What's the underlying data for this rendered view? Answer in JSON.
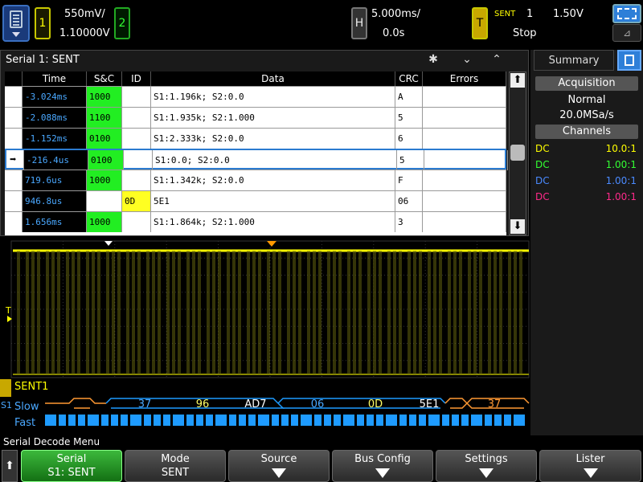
{
  "top": {
    "ch1_num": "1",
    "ch1_scale": "550mV/",
    "ch1_offset": "1.10000V",
    "ch2_num": "2",
    "h_label": "H",
    "h_scale": "5.000ms/",
    "h_delay": "0.0s",
    "t_label": "T",
    "trig_type": "SENT",
    "trig_source": "1",
    "trig_level": "1.50V",
    "run_state": "Stop",
    "zoom_icon": "zoom-icon",
    "menu_icon": "menu-icon"
  },
  "lister": {
    "title": "Serial 1: SENT",
    "headers": [
      "Time",
      "S&C",
      "ID",
      "Data",
      "CRC",
      "Errors"
    ],
    "rows": [
      {
        "time": "-3.024ms",
        "sc": "1000",
        "id": "",
        "data": "S1:1.196k; S2:0.0",
        "crc": "A",
        "errors": ""
      },
      {
        "time": "-2.088ms",
        "sc": "1100",
        "id": "",
        "data": "S1:1.935k; S2:1.000",
        "crc": "5",
        "errors": ""
      },
      {
        "time": "-1.152ms",
        "sc": "0100",
        "id": "",
        "data": "S1:2.333k; S2:0.0",
        "crc": "6",
        "errors": ""
      },
      {
        "time": "-216.4us",
        "sc": "0100",
        "id": "",
        "data": "S1:0.0; S2:0.0",
        "crc": "5",
        "errors": ""
      },
      {
        "time": "719.6us",
        "sc": "1000",
        "id": "",
        "data": "S1:1.342k; S2:0.0",
        "crc": "F",
        "errors": ""
      },
      {
        "time": "946.8us",
        "sc": "",
        "id": "0D",
        "data": "5E1",
        "crc": "06",
        "errors": ""
      },
      {
        "time": "1.656ms",
        "sc": "1000",
        "id": "",
        "data": "S1:1.864k; S2:1.000",
        "crc": "3",
        "errors": ""
      }
    ]
  },
  "summary": {
    "tab_label": "Summary",
    "acq_title": "Acquisition",
    "acq_mode": "Normal",
    "acq_rate": "20.0MSa/s",
    "channels_title": "Channels",
    "channels": [
      {
        "coupling": "DC",
        "ratio": "10.0:1",
        "color": "#ffff00"
      },
      {
        "coupling": "DC",
        "ratio": "1.00:1",
        "color": "#33ff33"
      },
      {
        "coupling": "DC",
        "ratio": "1.00:1",
        "color": "#4a8aff"
      },
      {
        "coupling": "DC",
        "ratio": "1.00:1",
        "color": "#ff2a8a"
      }
    ]
  },
  "wave": {
    "trigger_marker": "T",
    "bus_label": "SENT1",
    "serial_marker": "S1",
    "slow_label": "Slow",
    "fast_label": "Fast",
    "slow_values": [
      "37",
      "96",
      "AD7",
      "06",
      "0D",
      "5E1",
      "37"
    ]
  },
  "menu": {
    "title": "Serial Decode Menu",
    "softkeys": [
      {
        "top": "Serial",
        "bottom": "S1: SENT"
      },
      {
        "top": "Mode",
        "bottom": "SENT"
      },
      {
        "top": "Source",
        "bottom": ""
      },
      {
        "top": "Bus Config",
        "bottom": ""
      },
      {
        "top": "Settings",
        "bottom": ""
      },
      {
        "top": "Lister",
        "bottom": ""
      }
    ]
  },
  "colors": {
    "ch1": "#ffff00",
    "accent": "#2e7fd8",
    "green": "#22ee22",
    "bus_blue": "#1e9bff"
  }
}
